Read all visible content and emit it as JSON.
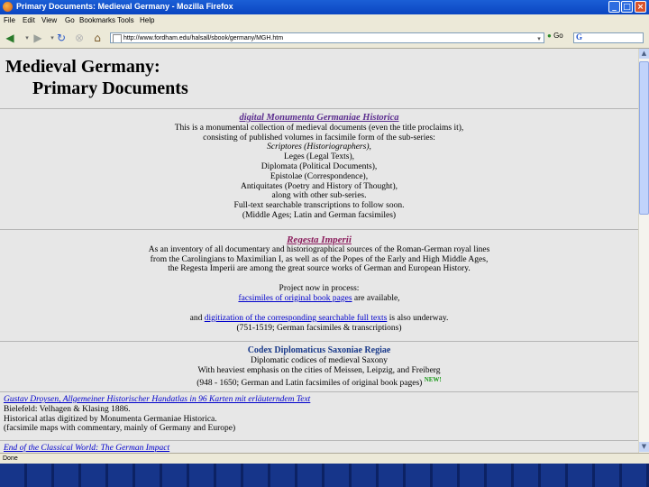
{
  "window": {
    "title": "Primary Documents: Medieval Germany - Mozilla Firefox"
  },
  "menu": [
    "File",
    "Edit",
    "View",
    "Go",
    "Bookmarks",
    "Tools",
    "Help"
  ],
  "address": {
    "url": "http://www.fordham.edu/halsall/sbook/germany/MGH.htm",
    "go_label": "Go"
  },
  "page": {
    "title_line1": "Medieval Germany:",
    "title_line2": "Primary Documents",
    "mgh": {
      "heading": "digital Monumenta Germaniae Historica",
      "lines": [
        "This is a monumental collection of medieval documents (even the title proclaims it),",
        "consisting of published volumes in facsimile form of the sub-series:",
        "Scriptores (Historiographers),",
        "Leges (Legal Texts),",
        "Diplomata (Political Documents),",
        "Epistolae (Correspondence),",
        "Antiquitates (Poetry and History of Thought),",
        "along with other sub-series.",
        "Full-text searchable transcriptions to follow soon.",
        "(Middle Ages; Latin and German facsimiles)"
      ]
    },
    "regesta": {
      "heading": "Regesta Imperii",
      "lines": [
        "As an inventory of all documentary and historiographical sources of the Roman-German royal lines",
        "from the Carolingians to Maximilian I, as well as of the Popes of the Early and High Middle Ages,",
        "the Regesta Imperii are among the great source works of German and European History."
      ],
      "project_label": "Project now in process:",
      "facsimiles_link": "facsimiles of original book pages",
      "facsimiles_suffix": " are available,",
      "digitization_prefix": "and ",
      "digitization_link": "digitization of the corresponding searchable full texts",
      "digitization_suffix": " is also underway.",
      "dates": "(751-1519; German facsimiles & transcriptions)"
    },
    "codex": {
      "heading": "Codex Diplomaticus Saxoniae Regiae",
      "lines": [
        "Diplomatic codices of medieval Saxony",
        "With heaviest emphasis on the cities of Meissen, Leipzig, and Freiberg",
        "(948 - 1650; German and Latin facsimiles of original book pages)"
      ],
      "new_badge": "NEW!"
    },
    "droysen": {
      "link": "Gustav Droysen, Allgemeiner Historischer Handatlas in 96 Karten mit erläuterndem Text",
      "lines": [
        "Bielefeld: Velhagen & Klasing 1886.",
        "Historical atlas digitized by Monumenta Germaniae Historica.",
        "(facsimile maps with commentary, mainly of Germany and Europe)"
      ]
    },
    "end_link": "End of the Classical World: The German Impact"
  },
  "status": {
    "text": "Done"
  },
  "colors": {
    "titlebar": "#0a45c1",
    "page_bg": "#e7e7e7",
    "link": "#0000cc",
    "heading_purple": "#5b2d8e",
    "new_green": "#1a9a1a",
    "taskbar": "#16358a"
  },
  "icons": [
    "firefox-icon",
    "back-icon",
    "forward-icon",
    "reload-icon",
    "stop-icon",
    "home-icon",
    "page-icon",
    "go-icon",
    "google-icon"
  ]
}
